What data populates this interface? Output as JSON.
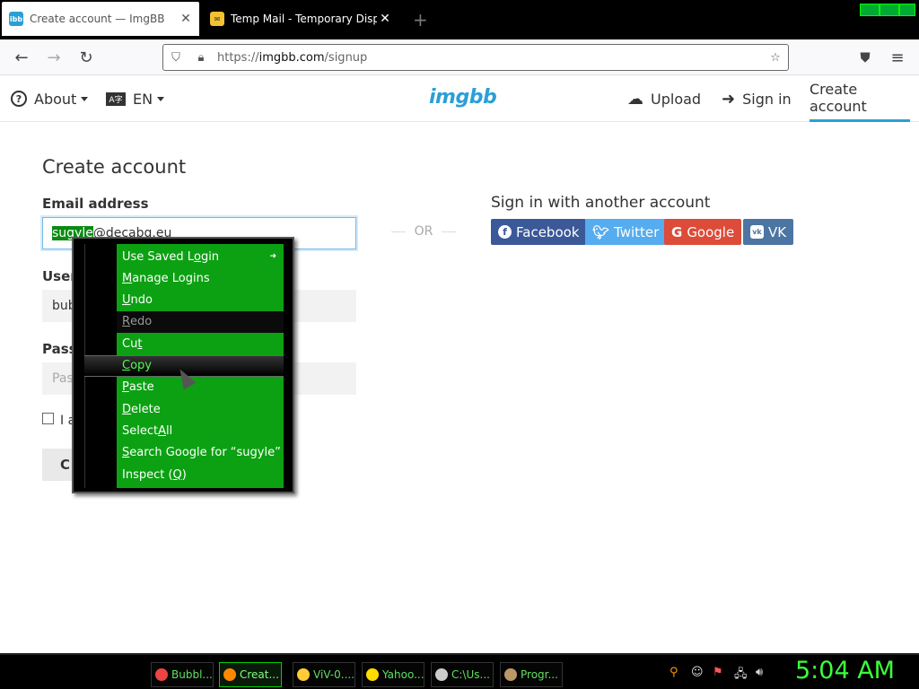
{
  "browser": {
    "tabs": [
      {
        "title": "Create account — ImgBB",
        "favicon": "ibb"
      },
      {
        "title": "Temp Mail - Temporary Dispos",
        "favicon": "mail-icon"
      }
    ],
    "url_scheme": "https://",
    "url_host": "imgbb.com",
    "url_path": "/signup"
  },
  "site": {
    "about": "About",
    "language": "EN",
    "logo": "imgbb",
    "upload": "Upload",
    "signin": "Sign in",
    "create": "Create account"
  },
  "form": {
    "heading": "Create account",
    "email_label": "Email address",
    "email_selected": "sugyle",
    "email_rest": "@decabg.eu",
    "username_label": "User",
    "username_value": "bub",
    "password_label": "Pass",
    "password_placeholder": "Pas",
    "checkbox_text": "I a",
    "submit_label": "C"
  },
  "alt_signin": {
    "or": "OR",
    "heading": "Sign in with another account",
    "buttons": [
      {
        "label": "Facebook",
        "icon": "f",
        "color": "#3b5998"
      },
      {
        "label": "Twitter",
        "icon": "t",
        "color": "#55acee"
      },
      {
        "label": "Google",
        "icon": "G",
        "color": "#dd4b39"
      },
      {
        "label": "VK",
        "icon": "vk",
        "color": "#4c75a3"
      }
    ]
  },
  "context_menu": {
    "items": [
      {
        "pre": "Use Saved L",
        "key": "o",
        "post": "gin",
        "has_submenu": true
      },
      {
        "pre": "",
        "key": "M",
        "post": "anage Logins"
      },
      {
        "pre": "",
        "key": "U",
        "post": "ndo"
      },
      {
        "pre": "",
        "key": "R",
        "post": "edo",
        "disabled": true
      },
      {
        "pre": "Cu",
        "key": "t",
        "post": ""
      },
      {
        "pre": "",
        "key": "C",
        "post": "opy",
        "hover": true
      },
      {
        "pre": "",
        "key": "P",
        "post": "aste"
      },
      {
        "pre": "",
        "key": "D",
        "post": "elete"
      },
      {
        "pre": "Select ",
        "key": "A",
        "post": "ll"
      },
      {
        "pre": "",
        "key": "S",
        "post": "earch Google for “sugyle”"
      },
      {
        "pre": "Inspect (",
        "key": "Q",
        "post": ")"
      }
    ]
  },
  "taskbar": {
    "tasks": [
      {
        "label": "Bubbl...",
        "icon_color": "#e44"
      },
      {
        "label": "Creat...",
        "icon_color": "#f80"
      },
      {
        "label": "ViV-0....",
        "icon_color": "#fc3"
      },
      {
        "label": "Yahoo...",
        "icon_color": "#fd0"
      },
      {
        "label": "C:\\Us...",
        "icon_color": "#ccc"
      },
      {
        "label": "Progr...",
        "icon_color": "#b96"
      }
    ],
    "clock": "5:04 AM"
  }
}
